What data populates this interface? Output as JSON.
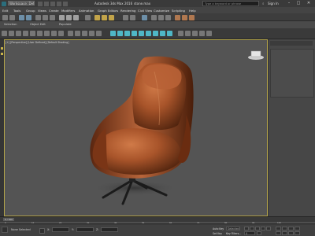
{
  "titlebar": {
    "workspace": "Workspace: Default",
    "app_title": "Autodesk 3ds Max 2016",
    "file_name": "stone.max",
    "search_placeholder": "Type a keyword or phrase",
    "sign_in": "Sign In",
    "minimize": "–",
    "maximize": "□",
    "close": "✕"
  },
  "menubar": {
    "items": [
      "Edit",
      "Tools",
      "Group",
      "Views",
      "Create",
      "Modifiers",
      "Animation",
      "Graph Editors",
      "Rendering",
      "Civil View",
      "Customize",
      "Scripting",
      "Help"
    ]
  },
  "ribbon": {
    "tabs": [
      "Selection",
      "Object Edit",
      "Populate"
    ]
  },
  "viewport": {
    "label": "[+] [Perspective] [User Defined] [Default Shading]",
    "accent_border": "#b3a44a",
    "chair_color": "#a8542a"
  },
  "timeline": {
    "frame_readout": "0 / 100",
    "ticks": [
      "0",
      "10",
      "20",
      "30",
      "40",
      "50",
      "60",
      "70",
      "80",
      "90",
      "100"
    ]
  },
  "statusbar": {
    "selection": "None Selected",
    "x_label": "X:",
    "y_label": "Y:",
    "z_label": "Z:",
    "auto_key": "Auto Key",
    "set_key": "Set Key",
    "selected": "Selected",
    "key_filters": "Key Filters...",
    "frame_value": "0"
  },
  "rightpanel": {
    "object_name": ""
  }
}
